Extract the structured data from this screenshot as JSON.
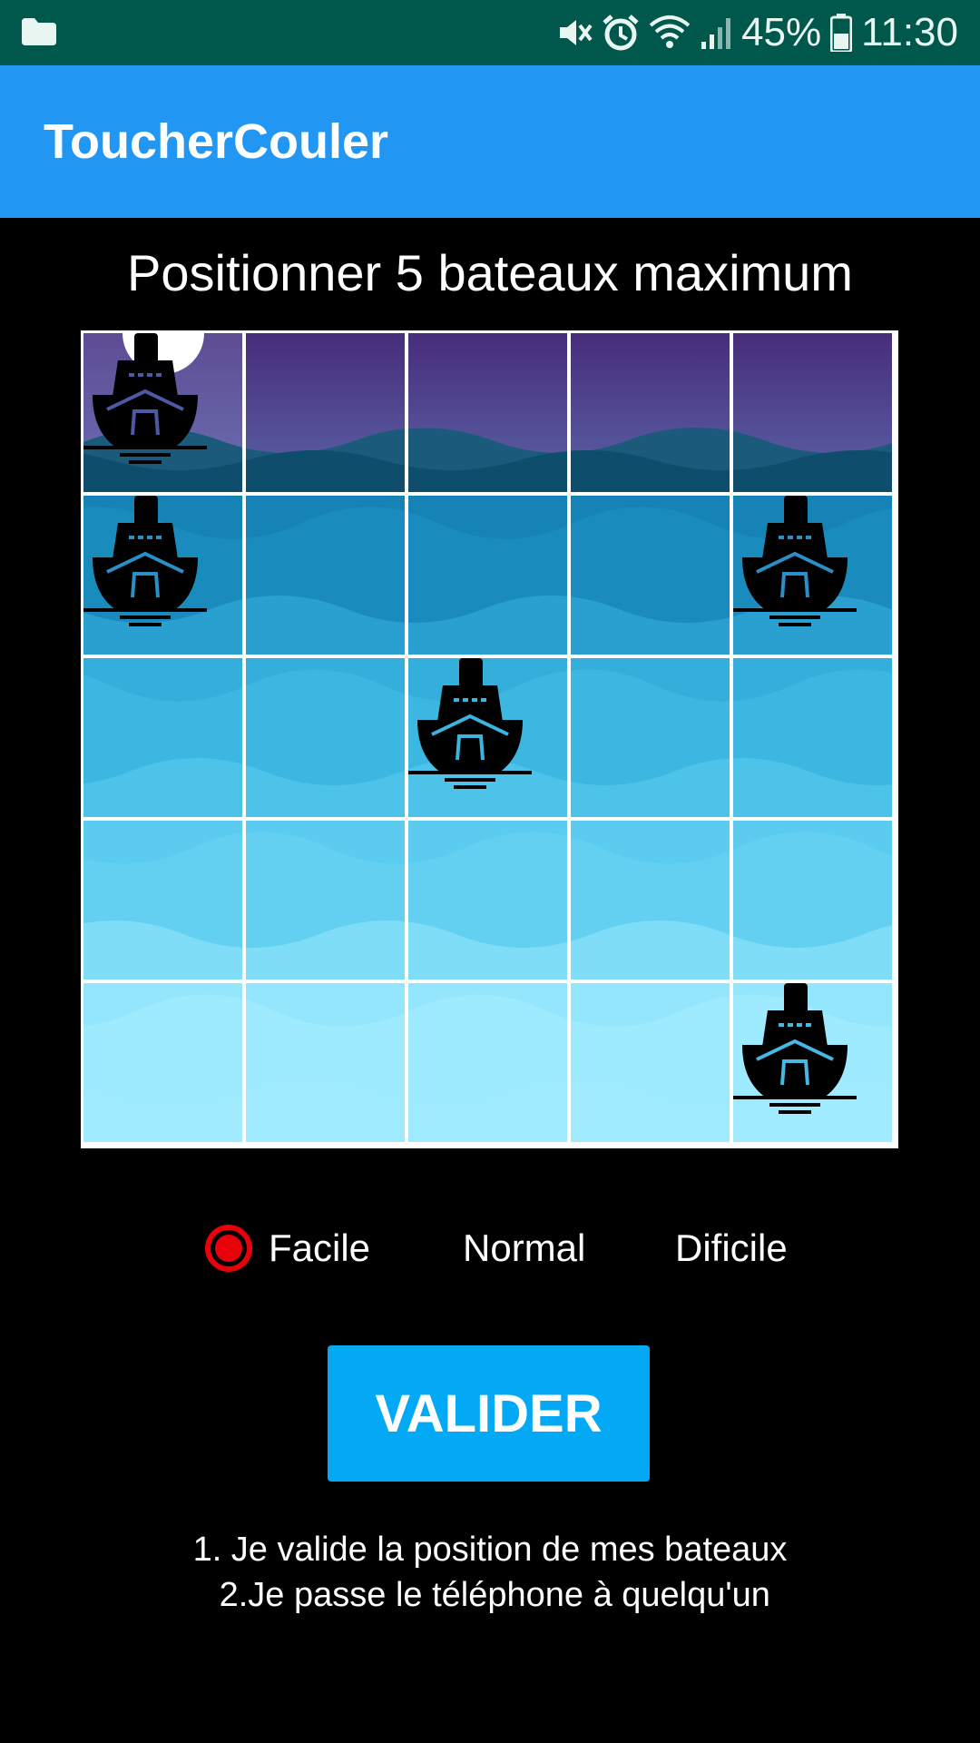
{
  "status_bar": {
    "battery": "45%",
    "time": "11:30",
    "icons": [
      "folder-icon",
      "mute-icon",
      "alarm-icon",
      "wifi-icon",
      "signal-icon",
      "battery-icon"
    ]
  },
  "app_bar": {
    "title": "ToucherCouler"
  },
  "instruction": {
    "title": "Positionner 5 bateaux maximum"
  },
  "board": {
    "rows": 5,
    "cols": 5,
    "ships": [
      [
        0,
        0
      ],
      [
        1,
        0
      ],
      [
        1,
        4
      ],
      [
        2,
        2
      ],
      [
        4,
        4
      ]
    ],
    "colors": {
      "row0_sky": "#472d7a",
      "row0_sea": "#0e4d6b",
      "row1": "#1583b6",
      "row2": "#34afdc",
      "row3": "#5bcbef",
      "row4": "#94e6fd",
      "moon": "#ffffff"
    }
  },
  "difficulty": {
    "options": [
      "Facile",
      "Normal",
      "Dificile"
    ],
    "selected": "Facile",
    "accent": "#e8000b"
  },
  "validate_button": {
    "label": "VALIDER",
    "color": "#03A9F4"
  },
  "help": {
    "line1": "1. Je valide la position de mes bateaux",
    "line2": " 2.Je passe le téléphone à quelqu'un"
  }
}
